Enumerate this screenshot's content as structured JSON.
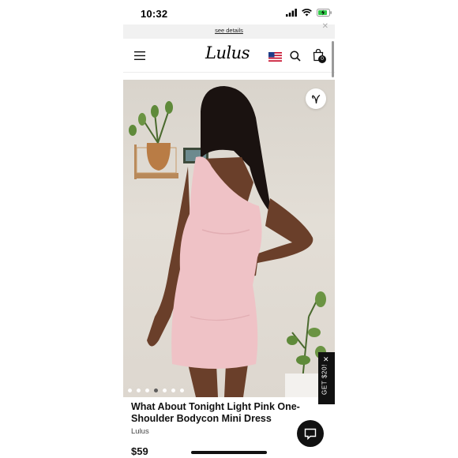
{
  "status_bar": {
    "time": "10:32"
  },
  "promo": {
    "link_text": "see details"
  },
  "header": {
    "logo": "Lulus",
    "cart_count": "0"
  },
  "gallery": {
    "dot_count": 7,
    "active_index": 3
  },
  "side_tab": {
    "label": "GET $20!"
  },
  "product": {
    "title": "What About Tonight Light Pink One-Shoulder Bodycon Mini Dress",
    "brand": "Lulus",
    "price": "$59"
  },
  "colors": {
    "accent": "#111111",
    "dress_pink": "#efc2c6",
    "skin": "#6a3f2a"
  }
}
